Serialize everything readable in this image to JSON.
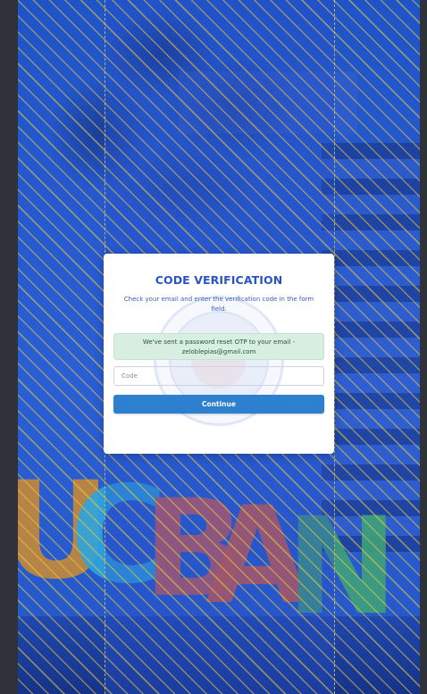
{
  "verification": {
    "title": "CODE VERIFICATION",
    "instructions": "Check your email and enter the verification code in the form field.",
    "alert_message": "We've sent a password reset OTP to your email - zeloblepias@gmail.com",
    "code_placeholder": "Code",
    "code_value": "",
    "continue_label": "Continue"
  },
  "background_sign": {
    "letters": [
      "U",
      "C",
      "B",
      "A",
      "N"
    ],
    "colors": [
      "#d99a3a",
      "#2ea6df",
      "#d9534f",
      "#e2553f",
      "#3aa37a"
    ]
  }
}
